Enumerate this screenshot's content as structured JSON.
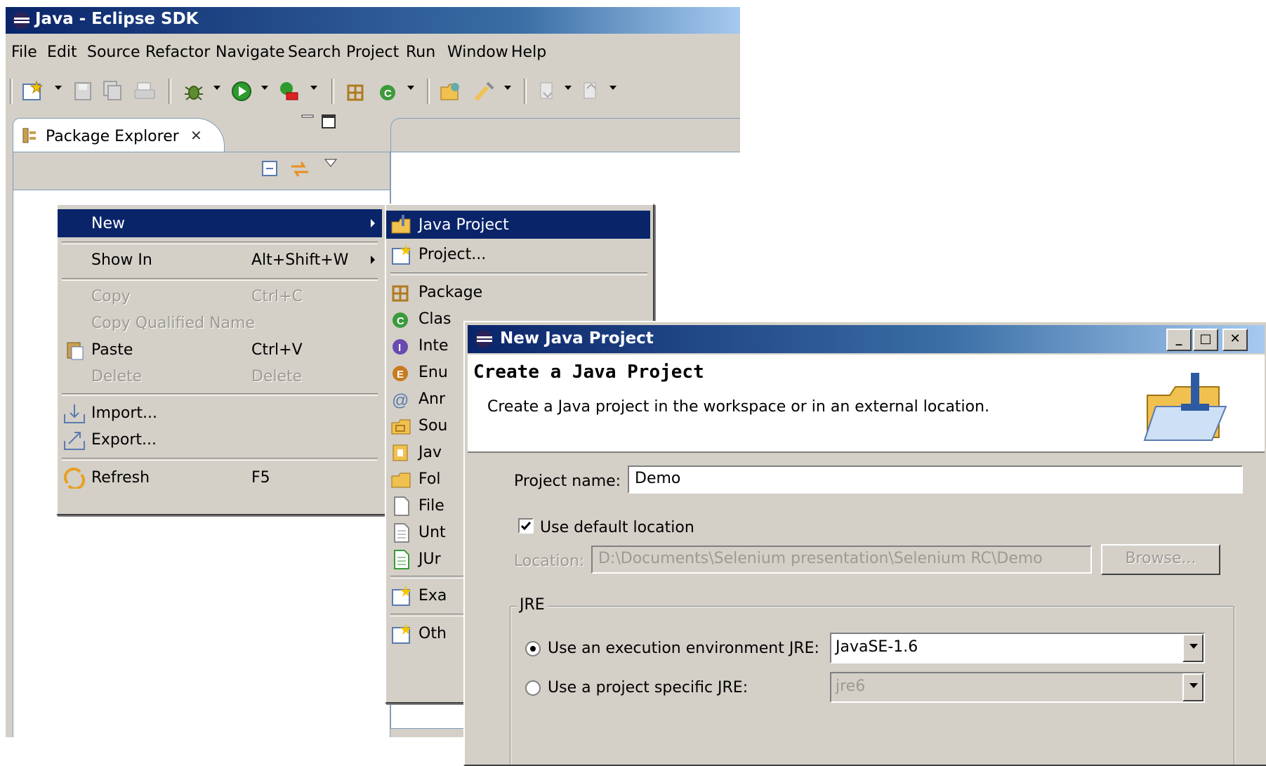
{
  "eclipse": {
    "title": "Java - Eclipse SDK",
    "menu": [
      "File",
      "Edit",
      "Source",
      "Refactor",
      "Navigate",
      "Search",
      "Project",
      "Run",
      "Window",
      "Help"
    ],
    "package_explorer_tab": "Package Explorer"
  },
  "context_menu": {
    "items": [
      {
        "label": "New",
        "shortcut": "",
        "enabled": true,
        "highlighted": true,
        "submenu": true
      },
      {
        "label": "Show In",
        "shortcut": "Alt+Shift+W",
        "enabled": true,
        "submenu": true
      },
      {
        "label": "Copy",
        "shortcut": "Ctrl+C",
        "enabled": false
      },
      {
        "label": "Copy Qualified Name",
        "shortcut": "",
        "enabled": false
      },
      {
        "label": "Paste",
        "shortcut": "Ctrl+V",
        "enabled": true,
        "icon": "paste-icon"
      },
      {
        "label": "Delete",
        "shortcut": "Delete",
        "enabled": false
      },
      {
        "label": "Import...",
        "shortcut": "",
        "enabled": true,
        "icon": "import-icon"
      },
      {
        "label": "Export...",
        "shortcut": "",
        "enabled": true,
        "icon": "export-icon"
      },
      {
        "label": "Refresh",
        "shortcut": "F5",
        "enabled": true,
        "icon": "refresh-icon"
      }
    ]
  },
  "new_submenu": {
    "items": [
      {
        "label": "Java Project",
        "highlighted": true,
        "icon": "java-project-icon"
      },
      {
        "label": "Project...",
        "icon": "project-icon"
      },
      {
        "label": "Package",
        "icon": "package-icon"
      },
      {
        "label": "Clas",
        "icon": "class-icon"
      },
      {
        "label": "Inte",
        "icon": "interface-icon"
      },
      {
        "label": "Enu",
        "icon": "enum-icon"
      },
      {
        "label": "Anr",
        "icon": "annotation-icon"
      },
      {
        "label": "Sou",
        "icon": "source-folder-icon"
      },
      {
        "label": "Jav",
        "icon": "java-working-set-icon"
      },
      {
        "label": "Fol",
        "icon": "folder-icon"
      },
      {
        "label": "File",
        "icon": "file-icon"
      },
      {
        "label": "Unt",
        "icon": "untitled-file-icon"
      },
      {
        "label": "JUr",
        "icon": "junit-icon"
      },
      {
        "label": "Exa",
        "icon": "example-icon"
      },
      {
        "label": "Oth",
        "icon": "other-icon"
      }
    ]
  },
  "dialog": {
    "title": "New Java Project",
    "heading": "Create a Java Project",
    "description": "Create a Java project in the workspace or in an external location.",
    "project_name_label": "Project name:",
    "project_name_value": "Demo",
    "use_default_location_label": "Use default location",
    "use_default_location_checked": true,
    "location_label": "Location:",
    "location_value": "D:\\Documents\\Selenium presentation\\Selenium RC\\Demo",
    "browse_label": "Browse...",
    "jre_group_label": "JRE",
    "jre_option1_label": "Use an execution environment JRE:",
    "jre_option1_value": "JavaSE-1.6",
    "jre_option2_label": "Use a project specific JRE:",
    "jre_option2_value": "jre6",
    "selected_jre_option": 1
  }
}
